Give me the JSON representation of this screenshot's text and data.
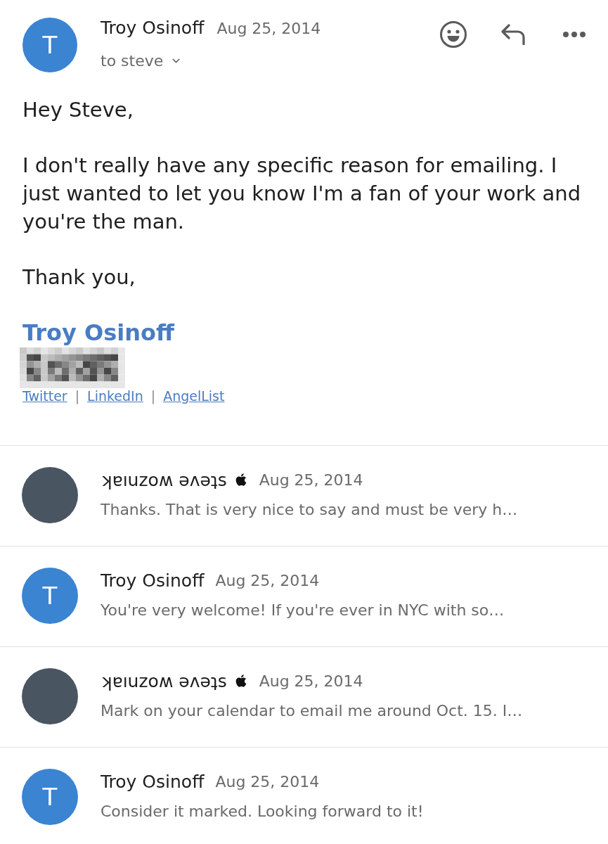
{
  "message": {
    "avatar": {
      "letter": "T",
      "color": "#3a84d2"
    },
    "sender": "Troy Osinoff",
    "date": "Aug 25, 2014",
    "recipients": "to steve",
    "body": [
      "Hey Steve,",
      "I don't really have any specific reason for emailing. I just wanted to let you know I'm a fan of your work and you're the man.",
      "Thank you,"
    ],
    "signature": {
      "name": "Troy Osinoff",
      "links": [
        "Twitter",
        "LinkedIn",
        "AngelList"
      ],
      "separator": "|"
    }
  },
  "thread": [
    {
      "avatar": {
        "color": "#4a5562"
      },
      "sender": "ʞɐıuzoʍ ǝʌǝʇs",
      "badge": true,
      "date": "Aug 25, 2014",
      "snippet": "Thanks. That is very nice to say and must be very h…"
    },
    {
      "avatar": {
        "letter": "T",
        "color": "#3a84d2"
      },
      "sender": "Troy Osinoff",
      "badge": false,
      "date": "Aug 25, 2014",
      "snippet": "You're very welcome! If you're ever in NYC with so…"
    },
    {
      "avatar": {
        "color": "#4a5562"
      },
      "sender": "ʞɐıuzoʍ ǝʌǝʇs",
      "badge": true,
      "date": "Aug 25, 2014",
      "snippet": "Mark on your calendar to email me around Oct. 15. I…"
    },
    {
      "avatar": {
        "letter": "T",
        "color": "#3a84d2"
      },
      "sender": "Troy Osinoff",
      "badge": false,
      "date": "Aug 25, 2014",
      "snippet": "Consider it marked. Looking forward to it!"
    }
  ]
}
